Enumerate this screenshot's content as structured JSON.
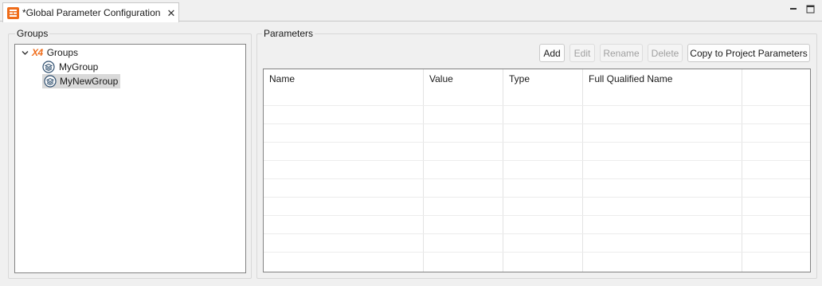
{
  "tab": {
    "title": "*Global Parameter Configuration",
    "close_symbol": "✕",
    "accent": "#ef6c1a"
  },
  "groups_panel": {
    "label": "Groups",
    "tree": [
      {
        "label": "Groups",
        "icon": "x4-logo-icon",
        "expanded": true,
        "level": 0
      },
      {
        "label": "MyGroup",
        "icon": "stack-icon",
        "level": 1
      },
      {
        "label": "MyNewGroup",
        "icon": "stack-icon",
        "level": 1,
        "selected": true
      }
    ],
    "root_logo_text": "X4"
  },
  "parameters_panel": {
    "label": "Parameters",
    "buttons": {
      "add": "Add",
      "edit": "Edit",
      "rename": "Rename",
      "delete": "Delete",
      "copy": "Copy to Project Parameters"
    },
    "columns": [
      "Name",
      "Value",
      "Type",
      "Full Qualified Name"
    ],
    "rows": []
  }
}
